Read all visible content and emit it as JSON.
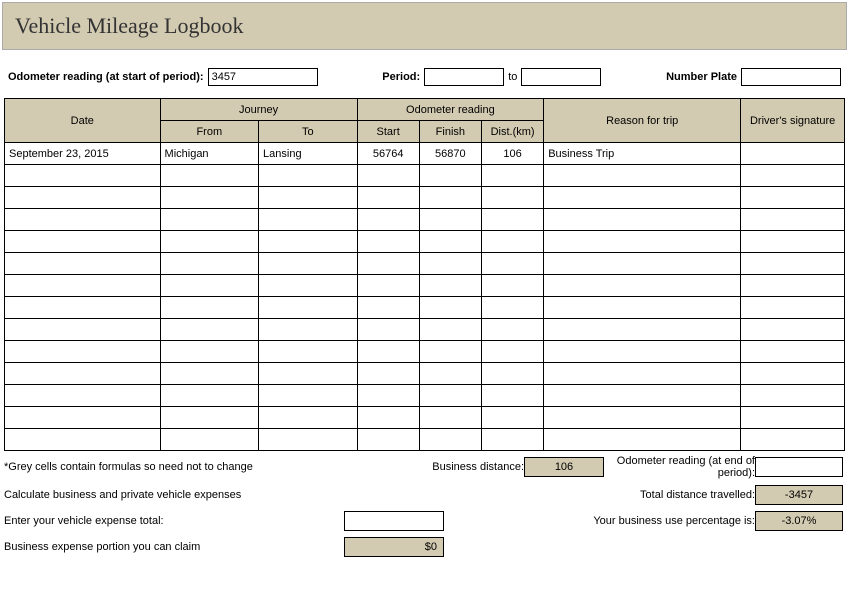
{
  "title": "Vehicle Mileage Logbook",
  "header": {
    "odometer_start_label": "Odometer reading (at start of period):",
    "odometer_start_value": "3457",
    "period_label": "Period:",
    "period_from": "",
    "period_to_label": "to",
    "period_to": "",
    "number_plate_label": "Number Plate",
    "number_plate_value": ""
  },
  "table": {
    "headers": {
      "date": "Date",
      "journey": "Journey",
      "from": "From",
      "to": "To",
      "odometer": "Odometer reading",
      "start": "Start",
      "finish": "Finish",
      "dist": "Dist.(km)",
      "reason": "Reason for trip",
      "signature": "Driver's signature"
    },
    "rows": [
      {
        "date": "September 23, 2015",
        "from": "Michigan",
        "to": "Lansing",
        "start": "56764",
        "finish": "56870",
        "dist": "106",
        "reason": "Business Trip",
        "sig": ""
      },
      {
        "date": "",
        "from": "",
        "to": "",
        "start": "",
        "finish": "",
        "dist": "",
        "reason": "",
        "sig": ""
      },
      {
        "date": "",
        "from": "",
        "to": "",
        "start": "",
        "finish": "",
        "dist": "",
        "reason": "",
        "sig": ""
      },
      {
        "date": "",
        "from": "",
        "to": "",
        "start": "",
        "finish": "",
        "dist": "",
        "reason": "",
        "sig": ""
      },
      {
        "date": "",
        "from": "",
        "to": "",
        "start": "",
        "finish": "",
        "dist": "",
        "reason": "",
        "sig": ""
      },
      {
        "date": "",
        "from": "",
        "to": "",
        "start": "",
        "finish": "",
        "dist": "",
        "reason": "",
        "sig": ""
      },
      {
        "date": "",
        "from": "",
        "to": "",
        "start": "",
        "finish": "",
        "dist": "",
        "reason": "",
        "sig": ""
      },
      {
        "date": "",
        "from": "",
        "to": "",
        "start": "",
        "finish": "",
        "dist": "",
        "reason": "",
        "sig": ""
      },
      {
        "date": "",
        "from": "",
        "to": "",
        "start": "",
        "finish": "",
        "dist": "",
        "reason": "",
        "sig": ""
      },
      {
        "date": "",
        "from": "",
        "to": "",
        "start": "",
        "finish": "",
        "dist": "",
        "reason": "",
        "sig": ""
      },
      {
        "date": "",
        "from": "",
        "to": "",
        "start": "",
        "finish": "",
        "dist": "",
        "reason": "",
        "sig": ""
      },
      {
        "date": "",
        "from": "",
        "to": "",
        "start": "",
        "finish": "",
        "dist": "",
        "reason": "",
        "sig": ""
      },
      {
        "date": "",
        "from": "",
        "to": "",
        "start": "",
        "finish": "",
        "dist": "",
        "reason": "",
        "sig": ""
      },
      {
        "date": "",
        "from": "",
        "to": "",
        "start": "",
        "finish": "",
        "dist": "",
        "reason": "",
        "sig": ""
      }
    ]
  },
  "footer": {
    "note": "*Grey cells contain formulas so need not to change",
    "business_distance_label": "Business distance:",
    "business_distance_value": "106",
    "odometer_end_label": "Odometer reading (at end of period):",
    "odometer_end_value": "",
    "calc_label": "Calculate business and private vehicle expenses",
    "total_distance_label": "Total distance travelled:",
    "total_distance_value": "-3457",
    "expense_total_label": "Enter your vehicle expense total:",
    "expense_total_value": "",
    "business_pct_label": "Your business use percentage is:",
    "business_pct_value": "-3.07%",
    "claim_label": "Business expense portion you can claim",
    "claim_value": "$0"
  }
}
